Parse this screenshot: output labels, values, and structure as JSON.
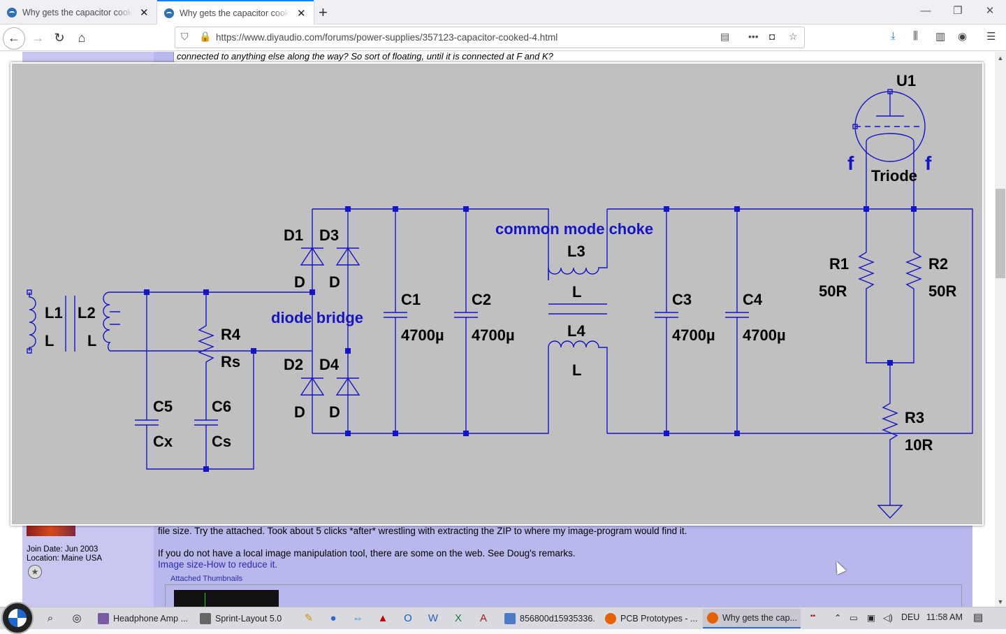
{
  "browser": {
    "tabs": [
      {
        "title": "Why gets the capacitor cooked"
      },
      {
        "title": "Why gets the capacitor cooked"
      }
    ],
    "url": "https://www.diyaudio.com/forums/power-supplies/357123-capacitor-cooked-4.html"
  },
  "post": {
    "quote_line": "connected to anything else along the way? So sort of floating, until it is connected at F and K?",
    "join_date": "Join Date: Jun 2003",
    "location": "Location: Maine USA",
    "line1": "file size. Try the attached. Took about 5 clicks *after* wrestling with extracting the ZIP to where my image-program would find it.",
    "line2": "If you do not have a local image manipulation tool, there are some on the web. See Doug's remarks.",
    "link": "Image size-How to reduce it.",
    "thumbnails_label": "Attached Thumbnails"
  },
  "schematic": {
    "labels": {
      "u1": "U1",
      "triode": "Triode",
      "f_left": "f",
      "f_right": "f",
      "l1": "L1",
      "l1_val": "L",
      "l2": "L2",
      "l2_val": "L",
      "r4": "R4",
      "r4_val": "Rs",
      "c5": "C5",
      "c5_val": "Cx",
      "c6": "C6",
      "c6_val": "Cs",
      "d1": "D1",
      "d3": "D3",
      "d1_val": "D",
      "d3_val": "D",
      "d2": "D2",
      "d4": "D4",
      "d2_val": "D",
      "d4_val": "D",
      "bridge": "diode bridge",
      "c1": "C1",
      "c1_val": "4700µ",
      "c2": "C2",
      "c2_val": "4700µ",
      "choke": "common mode choke",
      "l3": "L3",
      "l3_val": "L",
      "l4": "L4",
      "l4_val": "L",
      "c3": "C3",
      "c3_val": "4700µ",
      "c4": "C4",
      "c4_val": "4700µ",
      "r1": "R1",
      "r1_val": "50R",
      "r2": "R2",
      "r2_val": "50R",
      "r3": "R3",
      "r3_val": "10R"
    }
  },
  "taskbar": {
    "apps": [
      {
        "label": "Headphone Amp ..."
      },
      {
        "label": "Sprint-Layout 5.0"
      },
      {
        "label": "856800d15935336..."
      },
      {
        "label": "PCB Prototypes - ..."
      },
      {
        "label": "Why gets the cap..."
      }
    ],
    "lang": "DEU",
    "time": "11:58 AM"
  },
  "colors": {
    "wire": "#1414c8",
    "overlay_bg": "#c0c0c0",
    "post_bg": "#b8b8ec",
    "accent": "#0a84ff"
  }
}
